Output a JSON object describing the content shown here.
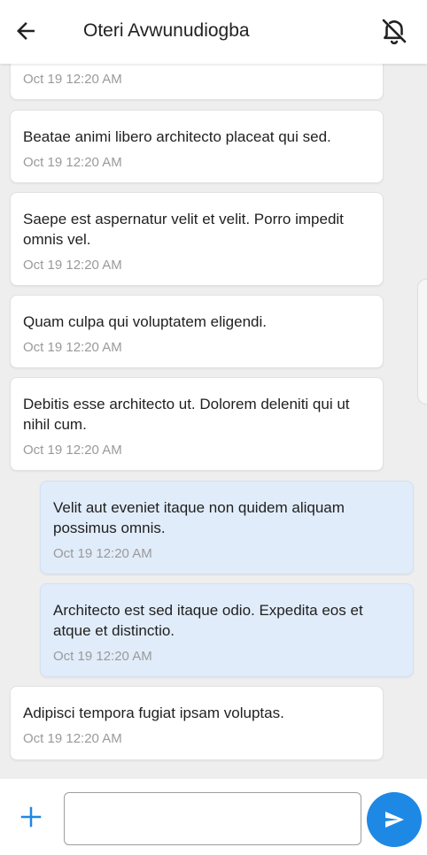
{
  "header": {
    "back_icon": "arrow-left-icon",
    "title": "Oteri Avwunudiogba",
    "mute_icon": "bell-off-icon"
  },
  "messages": [
    {
      "direction": "received",
      "text": "",
      "time": "Oct 19 12:20 AM"
    },
    {
      "direction": "received",
      "text": "Beatae animi libero architecto placeat qui sed.",
      "time": "Oct 19 12:20 AM"
    },
    {
      "direction": "received",
      "text": "Saepe est aspernatur velit et velit. Porro impedit omnis vel.",
      "time": "Oct 19 12:20 AM"
    },
    {
      "direction": "received",
      "text": "Quam culpa qui voluptatem eligendi.",
      "time": "Oct 19 12:20 AM"
    },
    {
      "direction": "received",
      "text": "Debitis esse architecto ut. Dolorem deleniti qui ut nihil cum.",
      "time": "Oct 19 12:20 AM"
    },
    {
      "direction": "sent",
      "text": "Velit aut eveniet itaque non quidem aliquam possimus omnis.",
      "time": "Oct 19 12:20 AM"
    },
    {
      "direction": "sent",
      "text": "Architecto est sed itaque odio. Expedita eos et atque et distinctio.",
      "time": "Oct 19 12:20 AM"
    },
    {
      "direction": "received",
      "text": "Adipisci tempora fugiat ipsam voluptas.",
      "time": "Oct 19 12:20 AM"
    }
  ],
  "composer": {
    "attach_icon": "plus-icon",
    "input_value": "",
    "send_icon": "send-icon"
  },
  "colors": {
    "accent": "#1e88e5",
    "sent_bubble": "#e1ecfa",
    "received_bubble": "#ffffff",
    "background": "#eeeeee"
  }
}
